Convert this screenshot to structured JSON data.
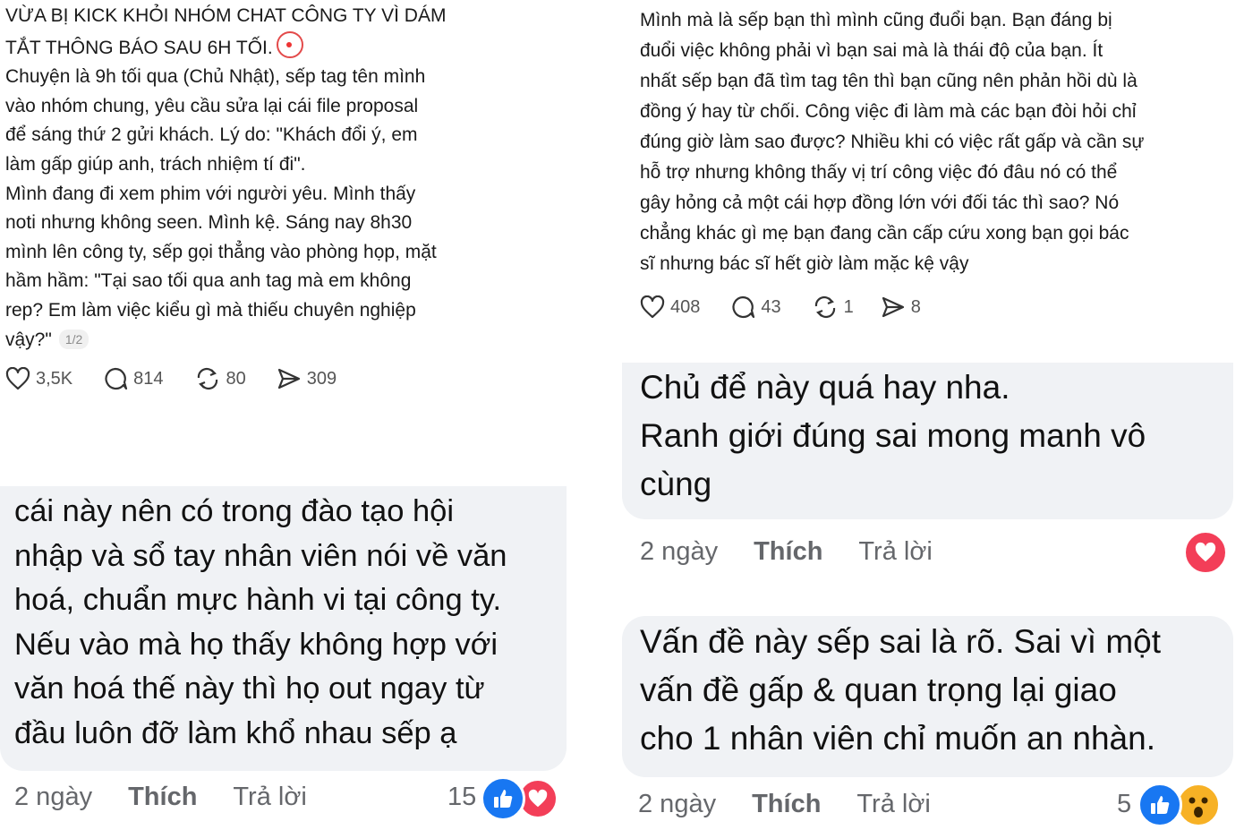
{
  "left_post": {
    "title_line1": "VỪA BỊ KICK KHỎI NHÓM CHAT CÔNG TY VÌ DÁM",
    "title_line2": "TẮT THÔNG BÁO SAU 6H TỐI.",
    "para1": [
      "Chuyện là 9h tối qua (Chủ Nhật), sếp tag tên mình",
      "vào nhóm chung, yêu cầu sửa lại cái file proposal",
      "để sáng thứ 2 gửi khách. Lý do: \"Khách đổi ý, em",
      "làm gấp giúp anh, trách nhiệm tí đi\"."
    ],
    "para2": [
      "Mình đang đi xem phim với người yêu. Mình thấy",
      "noti nhưng không seen. Mình kệ. Sáng nay 8h30",
      "mình lên công ty, sếp gọi thẳng vào phòng họp, mặt",
      "hầm hầm: \"Tại sao tối qua anh tag mà em không",
      "rep? Em làm việc kiểu gì mà thiếu chuyên nghiệp",
      "vậy?\""
    ],
    "page_indicator": "1/2",
    "stats": {
      "likes": "3,5K",
      "comments": "814",
      "reposts": "80",
      "shares": "309"
    }
  },
  "right_post": {
    "lines": [
      "Mình mà là sếp bạn thì mình cũng đuổi bạn. Bạn đáng bị",
      "đuổi việc không phải vì bạn sai mà là thái độ của bạn. Ít",
      "nhất sếp bạn đã tìm tag tên thì bạn cũng nên phản hồi dù là",
      "đồng ý hay từ chối. Công việc đi làm mà các bạn đòi hỏi chỉ",
      "đúng giờ làm sao được? Nhiều khi có việc rất gấp và cần sự",
      "hỗ trợ nhưng không thấy vị trí công việc đó đâu nó có thể",
      "gây hỏng cả một cái hợp đồng lớn với đối tác thì sao? Nó",
      "chẳng khác gì mẹ bạn đang cần cấp cứu xong bạn gọi bác",
      "sĩ nhưng bác sĩ hết giờ làm mặc kệ vậy"
    ],
    "stats": {
      "likes": "408",
      "comments": "43",
      "reposts": "1",
      "shares": "8"
    }
  },
  "comment_left": {
    "lines": [
      "cái này nên có trong đào tạo hội",
      "nhập và sổ tay nhân viên nói về văn",
      "hoá, chuẩn mực hành vi tại công ty.",
      "Nếu vào mà họ thấy không hợp với",
      "văn hoá thế này thì họ out ngay từ",
      "đầu luôn đỡ làm khổ nhau sếp ạ"
    ],
    "time": "2 ngày",
    "like": "Thích",
    "reply": "Trả lời",
    "reaction_count": "15"
  },
  "comment_right_top": {
    "lines": [
      "Chủ để này quá hay nha.",
      "Ranh giới đúng sai mong manh vô",
      "cùng"
    ],
    "time": "2 ngày",
    "like": "Thích",
    "reply": "Trả lời"
  },
  "comment_right_bottom": {
    "lines": [
      "Vấn đề này sếp sai là rõ. Sai vì một",
      "vấn đề gấp & quan trọng lại giao",
      "cho 1 nhân viên chỉ muốn an nhàn."
    ],
    "time": "2 ngày",
    "like": "Thích",
    "reply": "Trả lời",
    "reaction_count": "5"
  },
  "icons": {
    "like": "heart-outline-icon",
    "comment": "speech-bubble-icon",
    "repost": "repost-arrows-icon",
    "share": "send-icon",
    "reaction_like": "thumbs-up-reaction-icon",
    "reaction_love": "heart-reaction-icon",
    "reaction_wow": "wow-reaction-icon",
    "emoji": "clown-emoji-icon"
  },
  "colors": {
    "bubble_bg": "#f0f2f5",
    "like_blue": "#1877f2",
    "love_red": "#f33e58",
    "wow_yellow": "#f7b125",
    "muted": "#65676b"
  }
}
